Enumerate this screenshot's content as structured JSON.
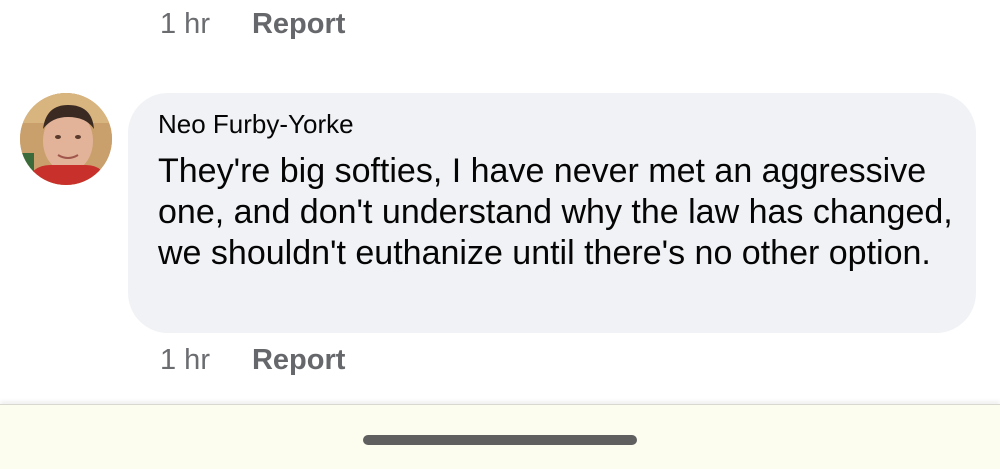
{
  "top_meta": {
    "time": "1 hr",
    "report_label": "Report"
  },
  "comment": {
    "author": "Neo Furby-Yorke",
    "text": "They're big softies, I have never met an aggressive one, and don't understand why the law has changed, we shouldn't euthanize until there's no other option.",
    "avatar_icon": "user-avatar-photo",
    "meta": {
      "time": "1 hr",
      "report_label": "Report"
    }
  },
  "navigation": {
    "handle_icon": "gesture-nav-handle"
  },
  "colors": {
    "bubble_bg": "#f0f2f5",
    "meta_text": "#65676b",
    "nav_bg": "#fcfcef"
  }
}
